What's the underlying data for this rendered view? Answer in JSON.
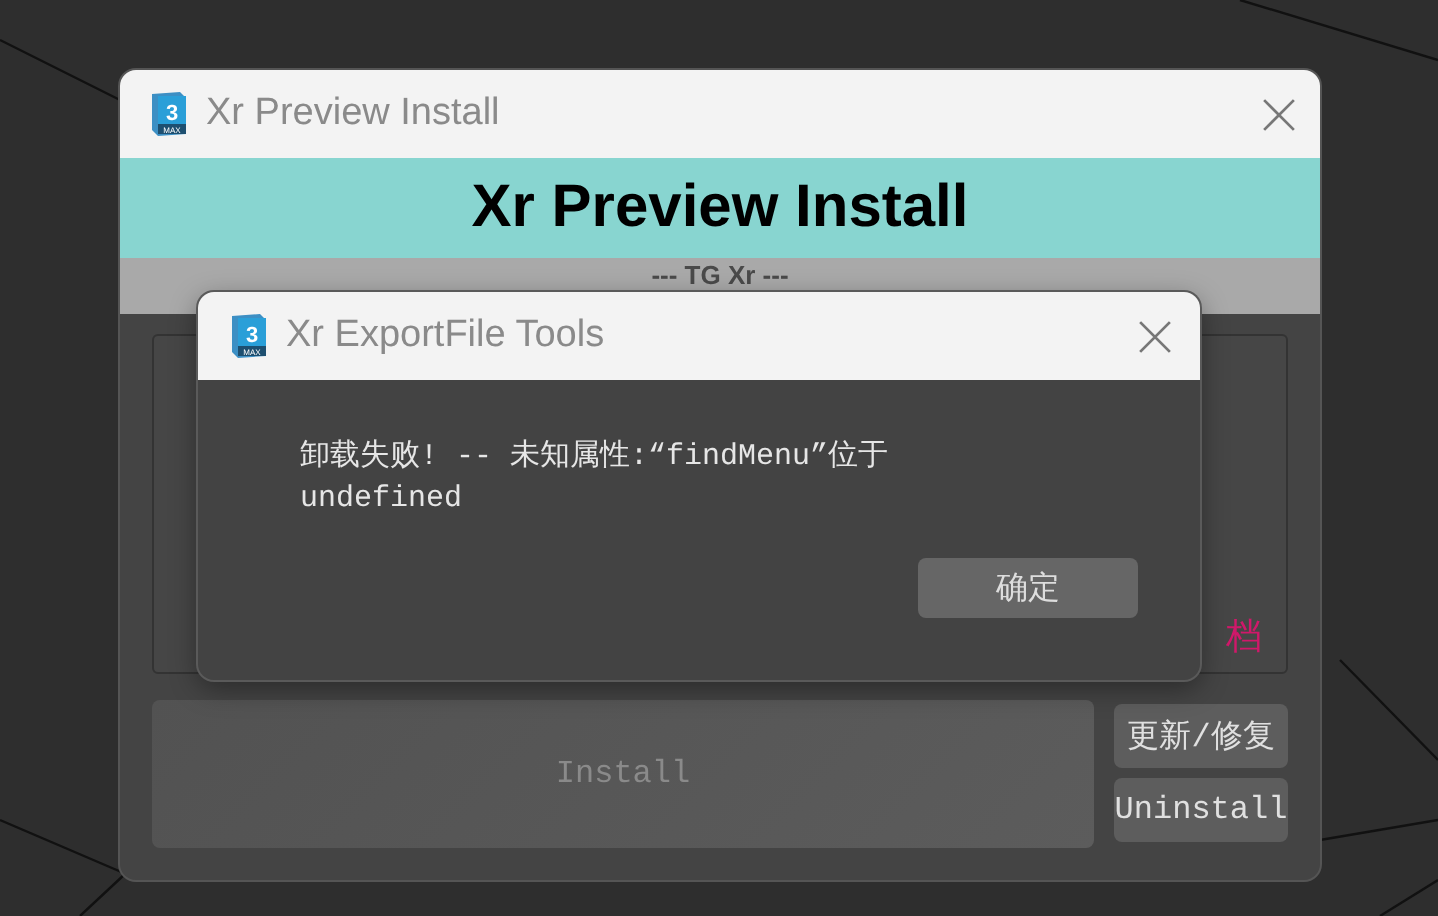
{
  "main_window": {
    "title": "Xr Preview Install",
    "banner": "Xr Preview Install",
    "subtitle": "--- TG Xr ---",
    "logo": {
      "number": "3",
      "caption": "MAX"
    },
    "panel_link": "档",
    "install_button": {
      "label": "Install",
      "disabled": true
    },
    "side_buttons": [
      "更新/修复",
      "Uninstall"
    ]
  },
  "dialog": {
    "title": "Xr ExportFile Tools",
    "logo": {
      "number": "3",
      "caption": "MAX"
    },
    "message": "卸载失败! -- 未知属性:“findMenu”位于 undefined",
    "buttons": [
      "确定"
    ]
  }
}
